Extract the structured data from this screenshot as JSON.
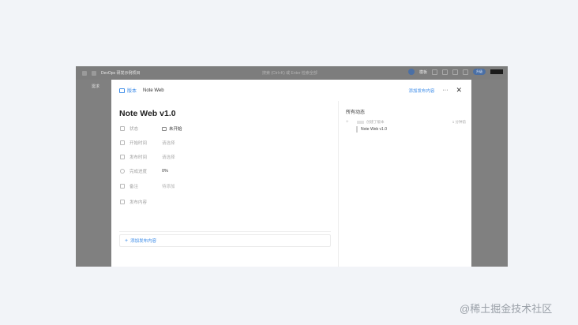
{
  "background_app": {
    "project_title": "DevOps 研发示例项目",
    "search_placeholder": "搜索 (Ctrl+K) 或 Enter 检索全部",
    "tab_label": "需求",
    "right_label": "模板",
    "pill_label": "升级"
  },
  "modal": {
    "breadcrumb_type": "版本",
    "breadcrumb_name": "Note Web",
    "add_related_label": "添加发布内容",
    "more_label": "···",
    "close_label": "✕",
    "title": "Note Web v1.0",
    "fields": [
      {
        "label": "状态",
        "value": "未开始",
        "icon": "status-icon"
      },
      {
        "label": "开始时间",
        "value": "请选择",
        "icon": "calendar-icon"
      },
      {
        "label": "发布时间",
        "value": "请选择",
        "icon": "calendar-icon"
      },
      {
        "label": "完成进度",
        "value": "0%",
        "icon": "progress-icon"
      },
      {
        "label": "备注",
        "value": "待添加",
        "icon": "note-icon"
      },
      {
        "label": "发布内容",
        "value": "",
        "icon": "list-icon"
      }
    ],
    "add_content_label": "添加发布内容",
    "activity": {
      "title": "所有动态",
      "entry_text": "创建了版本",
      "entry_time": "1 分钟前",
      "entry_detail": "Note Web v1.0"
    }
  },
  "watermark": "@稀土掘金技术社区",
  "colors": {
    "accent": "#3b8be8",
    "page_bg": "#f2f4f8",
    "overlay": "#808080"
  }
}
